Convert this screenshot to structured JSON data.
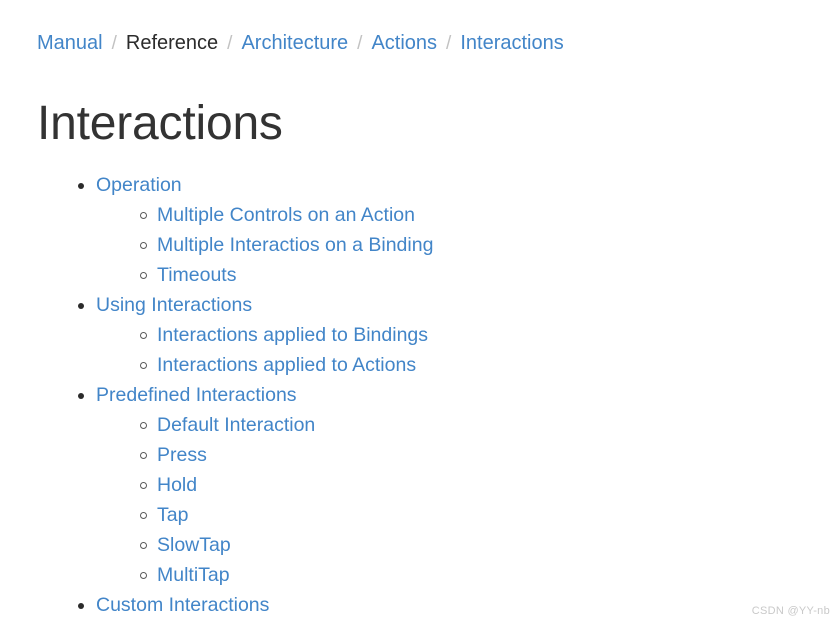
{
  "breadcrumb": {
    "separator": "/",
    "items": [
      {
        "label": "Manual",
        "current": false
      },
      {
        "label": "Reference",
        "current": true
      },
      {
        "label": "Architecture",
        "current": false
      },
      {
        "label": "Actions",
        "current": false
      },
      {
        "label": "Interactions",
        "current": false
      }
    ]
  },
  "page": {
    "title": "Interactions"
  },
  "toc": {
    "sections": [
      {
        "label": "Operation",
        "children": [
          {
            "label": "Multiple Controls on an Action"
          },
          {
            "label": "Multiple Interactios on a Binding"
          },
          {
            "label": "Timeouts"
          }
        ]
      },
      {
        "label": "Using Interactions",
        "children": [
          {
            "label": "Interactions applied to Bindings"
          },
          {
            "label": "Interactions applied to Actions"
          }
        ]
      },
      {
        "label": "Predefined Interactions",
        "children": [
          {
            "label": "Default Interaction"
          },
          {
            "label": "Press"
          },
          {
            "label": "Hold"
          },
          {
            "label": "Tap"
          },
          {
            "label": "SlowTap"
          },
          {
            "label": "MultiTap"
          }
        ]
      },
      {
        "label": "Custom Interactions",
        "children": []
      }
    ]
  },
  "watermark": {
    "text": "CSDN @YY-nb"
  },
  "colors": {
    "link": "#4285c8",
    "text": "#333333",
    "separator": "#c2c2c2",
    "background": "#ffffff",
    "watermark": "#c9c9c9"
  }
}
